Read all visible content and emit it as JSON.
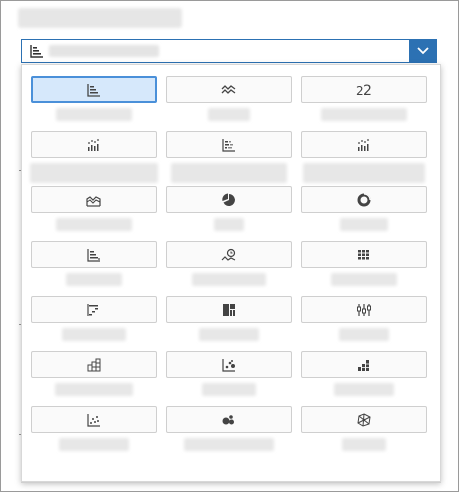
{
  "dialog": {
    "title": ""
  },
  "chart_type_select": {
    "value": "",
    "icon": "bar-chart-icon"
  },
  "colors": {
    "accent": "#2c71b3",
    "selected_bg": "#d6e8fb",
    "selected_border": "#4a90d9",
    "icon": "#4a4a4a"
  },
  "chart_types": [
    {
      "icon": "bar-chart-icon",
      "label": "",
      "selected": true
    },
    {
      "icon": "line-chart-icon",
      "label": "",
      "selected": false
    },
    {
      "icon": "numeric-point-icon",
      "label": "",
      "selected": false
    },
    {
      "icon": "column-dots-icon",
      "label": "",
      "selected": false
    },
    {
      "icon": "stacked-bar-icon",
      "label": "",
      "selected": false
    },
    {
      "icon": "column-dots-icon",
      "label": "",
      "selected": false
    },
    {
      "icon": "area-chart-icon",
      "label": "",
      "selected": false
    },
    {
      "icon": "pie-chart-icon",
      "label": "",
      "selected": false
    },
    {
      "icon": "donut-chart-icon",
      "label": "",
      "selected": false
    },
    {
      "icon": "combination-chart-icon",
      "label": "",
      "selected": false
    },
    {
      "icon": "time-series-icon",
      "label": "",
      "selected": false
    },
    {
      "icon": "heatmap-icon",
      "label": "",
      "selected": false
    },
    {
      "icon": "waterfall-icon",
      "label": "",
      "selected": false
    },
    {
      "icon": "treemap-icon",
      "label": "",
      "selected": false
    },
    {
      "icon": "boxplot-icon",
      "label": "",
      "selected": false
    },
    {
      "icon": "marimekko-icon",
      "label": "",
      "selected": false
    },
    {
      "icon": "scatter-bubble-icon",
      "label": "",
      "selected": false
    },
    {
      "icon": "stacked-column-icon",
      "label": "",
      "selected": false
    },
    {
      "icon": "scatter-plot-icon",
      "label": "",
      "selected": false
    },
    {
      "icon": "bubble-chart-icon",
      "label": "",
      "selected": false
    },
    {
      "icon": "network-chart-icon",
      "label": "",
      "selected": false
    }
  ]
}
